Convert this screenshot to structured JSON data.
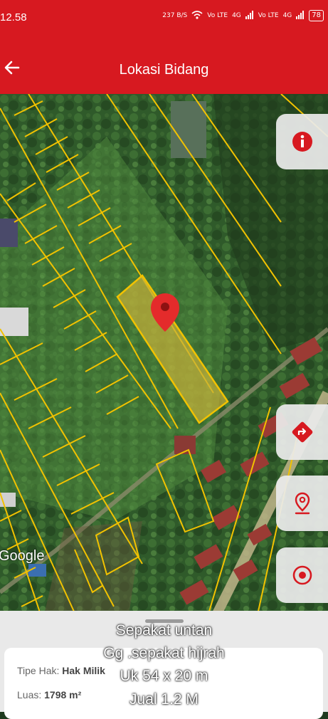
{
  "status_bar": {
    "time": "12.58",
    "data_speed": "237 B/S",
    "sim1": "Vo LTE",
    "signal1": "4G",
    "sim2": "Vo LTE",
    "signal2": "4G",
    "battery": "78"
  },
  "app_bar": {
    "title": "Lokasi Bidang"
  },
  "map": {
    "attribution": "Google"
  },
  "info_card": {
    "rows": [
      {
        "label": "Tipe Hak:",
        "value": "Hak Milik"
      },
      {
        "label": "Luas:",
        "value": "1798 m²"
      }
    ]
  },
  "caption": {
    "lines": [
      "Sepakat untan",
      "Gg .sepakat hijrah",
      "Uk 54 x 20 m",
      "Jual 1.2 M"
    ]
  },
  "colors": {
    "brand_red": "#d71920",
    "parcel_outline": "#f2c200",
    "selected_fill": "#c8b23a"
  }
}
